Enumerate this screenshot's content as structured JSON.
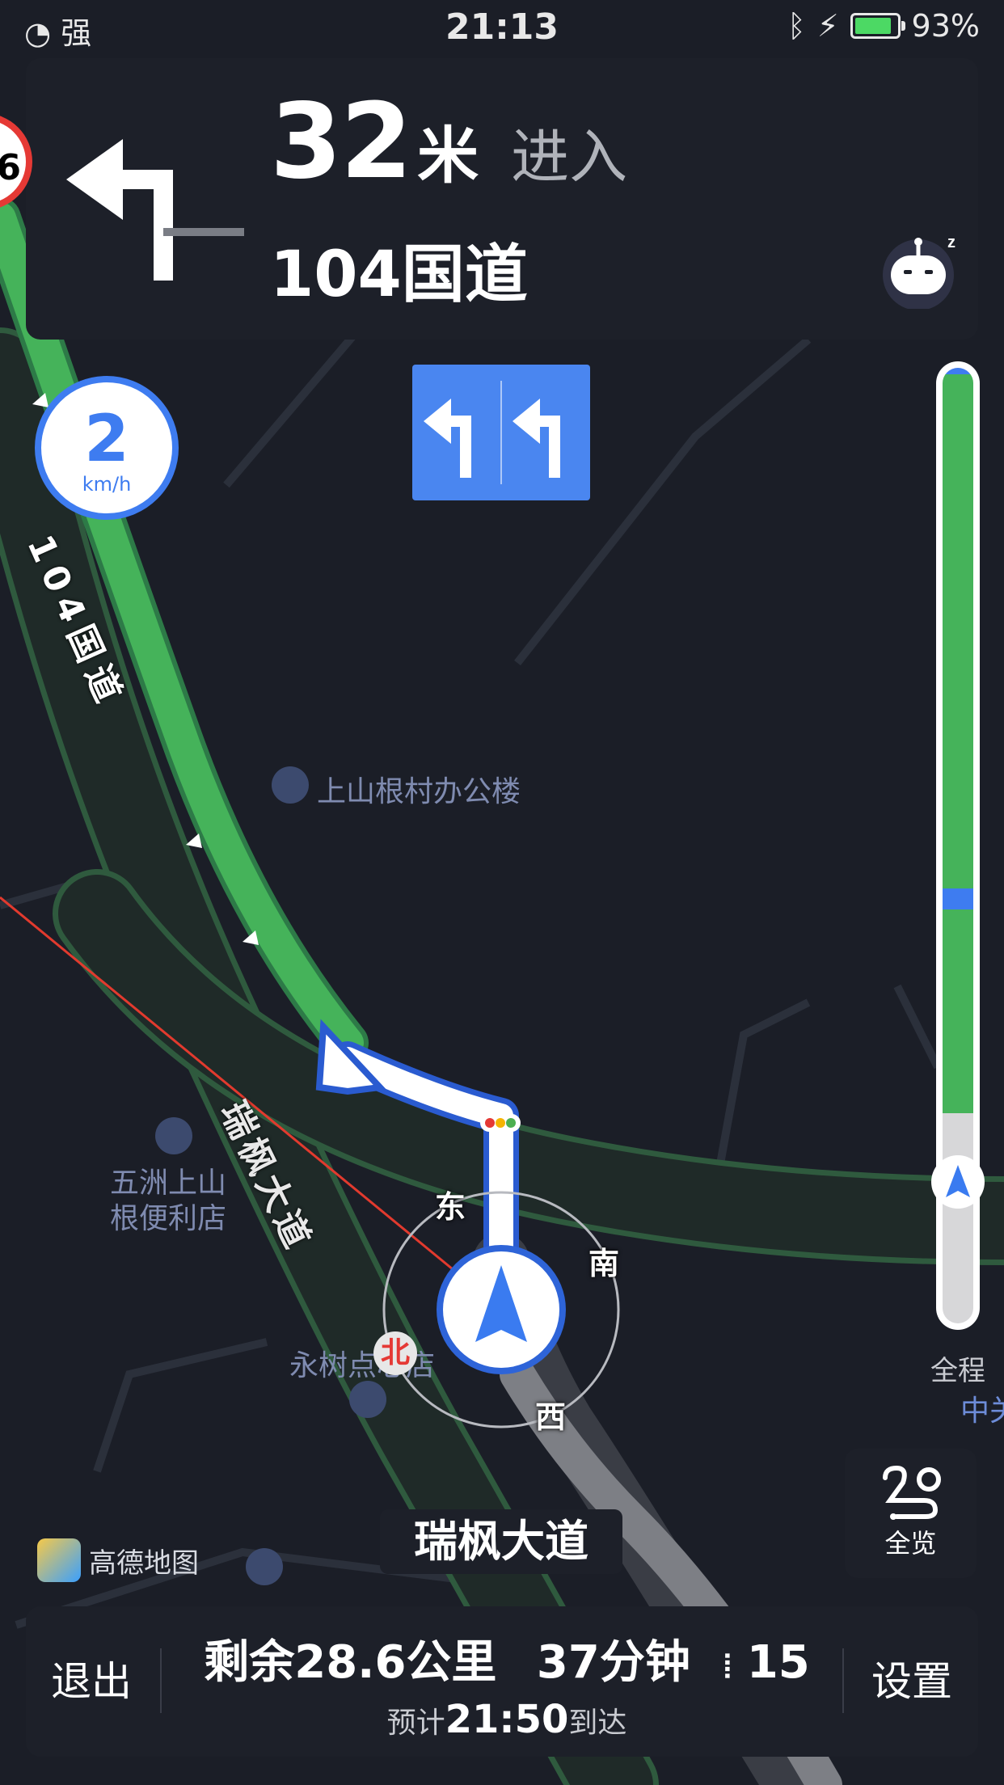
{
  "status_bar": {
    "signal": "强",
    "time": "21:13",
    "battery": "93%"
  },
  "guidance": {
    "distance": "32",
    "unit": "米",
    "action": "进入",
    "road": "104国道",
    "speed_limit_partial": "6"
  },
  "speed": {
    "value": "2",
    "unit": "km/h"
  },
  "map": {
    "road_label_main": "104国道",
    "road_label_side": "瑞枫大道",
    "poi_office": "上山根村办公楼",
    "poi_store_line1": "五洲上山",
    "poi_store_line2": "根便利店",
    "poi_shop": "永树点心店",
    "compass": {
      "east": "东",
      "south": "南",
      "west": "西",
      "north": "北"
    },
    "right_edge_label": "中关"
  },
  "progress": {
    "label": "全程",
    "current_fraction": 0.88
  },
  "overview_button": {
    "label": "全览"
  },
  "current_road": "瑞枫大道",
  "brand": "高德地图",
  "bottom_bar": {
    "exit": "退出",
    "settings": "设置",
    "remaining_distance": "剩余28.6公里",
    "remaining_time": "37分钟",
    "traffic_lights": "15",
    "eta_prefix": "预计",
    "eta_time": "21:50",
    "eta_suffix": "到达"
  },
  "colors": {
    "route_green": "#45b35a",
    "route_blue": "#4a86f0",
    "panel": "#1d2029",
    "map_bg": "#1b1e27"
  }
}
